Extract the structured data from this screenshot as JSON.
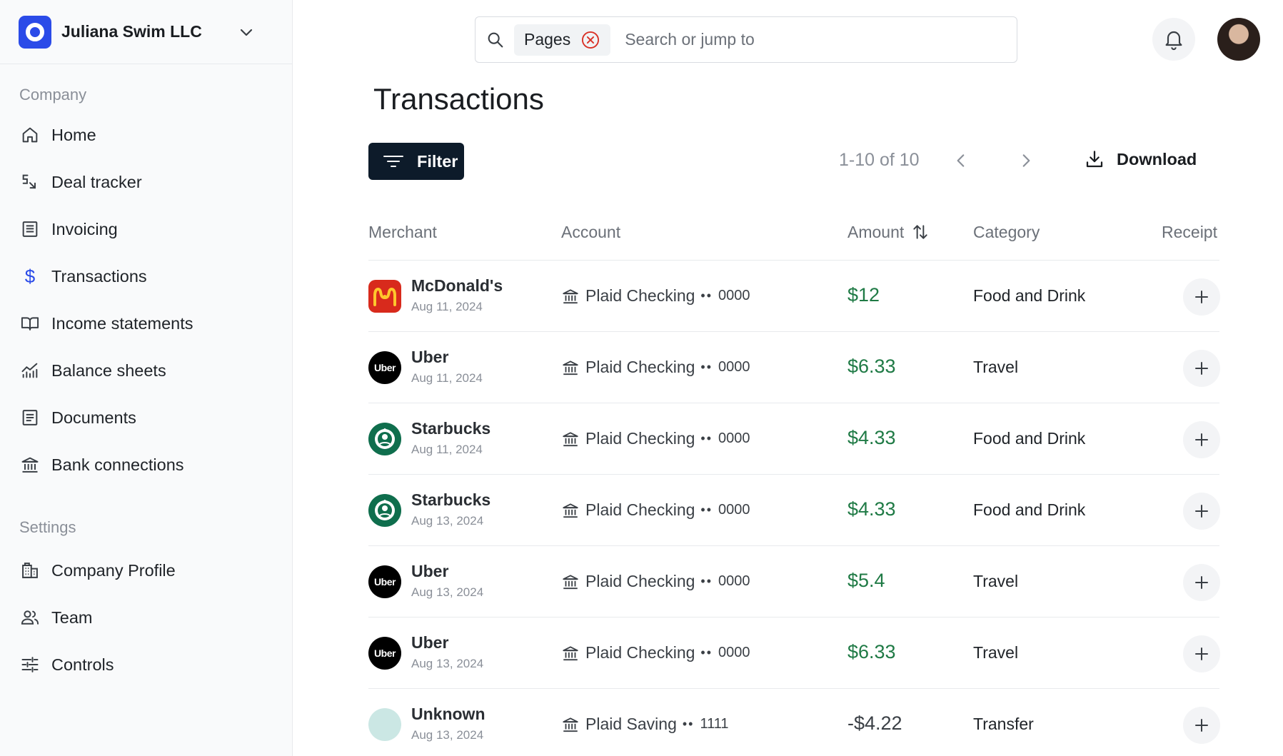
{
  "org": {
    "name": "Juliana Swim LLC"
  },
  "sidebar": {
    "company_title": "Company",
    "company_items": [
      {
        "label": "Home",
        "icon": "home-icon"
      },
      {
        "label": "Deal tracker",
        "icon": "deal-tracker-icon"
      },
      {
        "label": "Invoicing",
        "icon": "invoice-icon"
      },
      {
        "label": "Transactions",
        "icon": "dollar-icon",
        "active": true
      },
      {
        "label": "Income statements",
        "icon": "book-icon"
      },
      {
        "label": "Balance sheets",
        "icon": "chart-icon"
      },
      {
        "label": "Documents",
        "icon": "document-icon"
      },
      {
        "label": "Bank connections",
        "icon": "bank-icon"
      }
    ],
    "settings_title": "Settings",
    "settings_items": [
      {
        "label": "Company Profile",
        "icon": "building-icon"
      },
      {
        "label": "Team",
        "icon": "team-icon"
      },
      {
        "label": "Controls",
        "icon": "sliders-icon"
      }
    ]
  },
  "search": {
    "chip": "Pages",
    "placeholder": "Search or jump to"
  },
  "main": {
    "title": "Transactions",
    "filter_label": "Filter",
    "pager_text": "1-10 of 10",
    "download_label": "Download",
    "columns": {
      "merchant": "Merchant",
      "account": "Account",
      "amount": "Amount",
      "category": "Category",
      "receipt": "Receipt"
    }
  },
  "transactions": [
    {
      "merchant": "McDonald's",
      "date": "Aug 11, 2024",
      "account": "Plaid Checking",
      "account_num": "0000",
      "amount": "$12",
      "category": "Food and Drink",
      "logo": "mcd"
    },
    {
      "merchant": "Uber",
      "date": "Aug 11, 2024",
      "account": "Plaid Checking",
      "account_num": "0000",
      "amount": "$6.33",
      "category": "Travel",
      "logo": "uber"
    },
    {
      "merchant": "Starbucks",
      "date": "Aug 11, 2024",
      "account": "Plaid Checking",
      "account_num": "0000",
      "amount": "$4.33",
      "category": "Food and Drink",
      "logo": "sbux"
    },
    {
      "merchant": "Starbucks",
      "date": "Aug 13, 2024",
      "account": "Plaid Checking",
      "account_num": "0000",
      "amount": "$4.33",
      "category": "Food and Drink",
      "logo": "sbux"
    },
    {
      "merchant": "Uber",
      "date": "Aug 13, 2024",
      "account": "Plaid Checking",
      "account_num": "0000",
      "amount": "$5.4",
      "category": "Travel",
      "logo": "uber"
    },
    {
      "merchant": "Uber",
      "date": "Aug 13, 2024",
      "account": "Plaid Checking",
      "account_num": "0000",
      "amount": "$6.33",
      "category": "Travel",
      "logo": "uber"
    },
    {
      "merchant": "Unknown",
      "date": "Aug 13, 2024",
      "account": "Plaid Saving",
      "account_num": "1111",
      "amount": "-$4.22",
      "category": "Transfer",
      "logo": "unknown"
    }
  ],
  "logo_text": {
    "uber": "Uber"
  },
  "colors": {
    "brand": "#2b4be8",
    "positive_amount": "#1f7a45",
    "filter_button": "#0d1b2a"
  }
}
